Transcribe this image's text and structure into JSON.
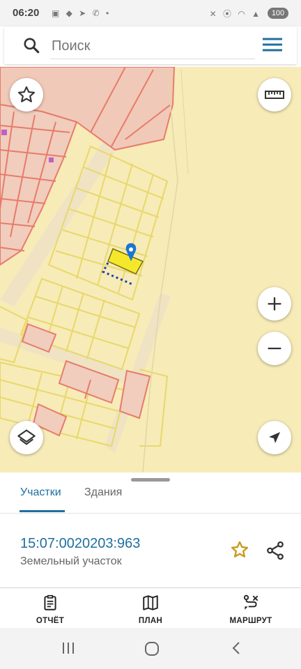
{
  "status_bar": {
    "time": "06:20",
    "left_icons": "▣ ◆ ➤ ✆ •",
    "right_icons": "✕ ⦿ ◠ ▲",
    "battery": "100"
  },
  "search": {
    "placeholder": "Поиск",
    "icon": "search-icon",
    "menu_icon": "hamburger-menu-icon"
  },
  "map": {
    "buttons": [
      "favorites-star-icon",
      "ruler-icon",
      "zoom-in-icon",
      "zoom-out-icon",
      "layers-icon",
      "my-location-icon"
    ],
    "colors": {
      "base": "#f7ebb8",
      "parcel_yellow": "#e8d86a",
      "parcel_red": "#e87b6a",
      "selected": "#f5e82a",
      "pin": "#1976d2"
    }
  },
  "sheet": {
    "tabs": [
      {
        "label": "Участки",
        "active": true
      },
      {
        "label": "Здания",
        "active": false
      }
    ],
    "parcel": {
      "cadastral_number": "15:07:0020203:963",
      "type": "Земельный участок"
    }
  },
  "bottom_nav": [
    {
      "label": "ОТЧЁТ",
      "icon": "report-clipboard-icon"
    },
    {
      "label": "ПЛАН",
      "icon": "map-plan-icon"
    },
    {
      "label": "МАРШРУТ",
      "icon": "route-icon"
    }
  ],
  "system_nav": [
    "recent-apps-icon",
    "home-icon",
    "back-icon"
  ]
}
